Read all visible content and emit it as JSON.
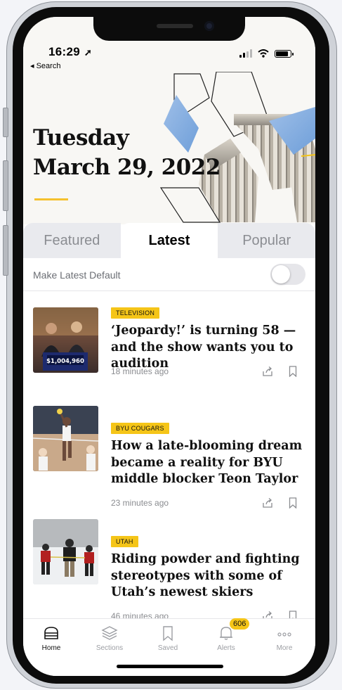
{
  "status": {
    "time": "16:29",
    "back_label": "Search"
  },
  "header": {
    "date_line1": "Tuesday",
    "date_line2": "March 29, 2022",
    "accent": "#f5c518"
  },
  "tabs": [
    {
      "label": "Featured",
      "active": false
    },
    {
      "label": "Latest",
      "active": true
    },
    {
      "label": "Popular",
      "active": false
    }
  ],
  "toggle": {
    "label": "Make Latest Default",
    "on": false
  },
  "articles": [
    {
      "tag": "TELEVISION",
      "headline": "‘Jeopardy!’ is turning 58 — and the show wants you to audition",
      "time": "18 minutes ago",
      "thumb_text": "$1,004,960"
    },
    {
      "tag": "BYU COUGARS",
      "headline": "How a late-blooming dream became a reality for BYU middle blocker Teon Taylor",
      "time": "23 minutes ago"
    },
    {
      "tag": "UTAH",
      "headline": "Riding powder and fighting stereotypes with some of Utah’s newest skiers",
      "time": "46 minutes ago"
    }
  ],
  "tabbar": {
    "items": [
      {
        "label": "Home",
        "icon": "home-icon",
        "active": true
      },
      {
        "label": "Sections",
        "icon": "layers-icon",
        "active": false
      },
      {
        "label": "Saved",
        "icon": "bookmark-icon",
        "active": false
      },
      {
        "label": "Alerts",
        "icon": "bell-icon",
        "active": false,
        "badge": "606"
      },
      {
        "label": "More",
        "icon": "more-icon",
        "active": false
      }
    ]
  }
}
